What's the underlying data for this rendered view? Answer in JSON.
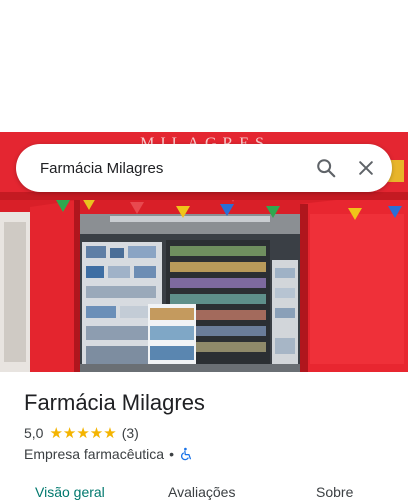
{
  "search": {
    "value": "Farmácia Milagres"
  },
  "photo": {
    "sign_text": "MILAGRES"
  },
  "place": {
    "title": "Farmácia Milagres",
    "rating": "5,0",
    "stars": "★★★★★",
    "review_count": "(3)",
    "category": "Empresa farmacêutica",
    "separator": "•"
  },
  "tabs": [
    {
      "label": "Visão geral"
    },
    {
      "label": "Avaliações"
    },
    {
      "label": "Sobre"
    }
  ],
  "icons": {
    "search": "search-icon",
    "close": "close-icon",
    "accessibility": "wheelchair-icon"
  },
  "colors": {
    "accent": "#00786d",
    "star": "#f4b400",
    "accessibility": "#1a73e8",
    "storefront_red": "#e0202a"
  }
}
